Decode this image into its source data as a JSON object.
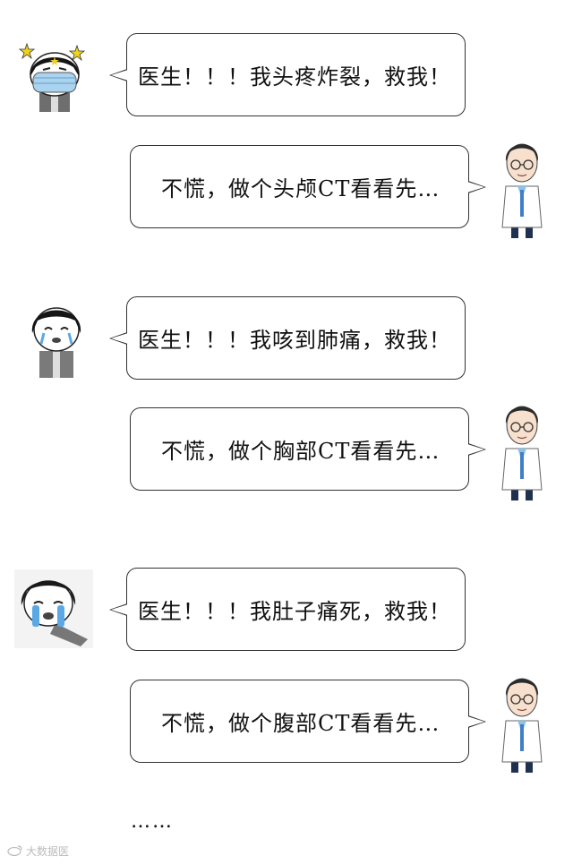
{
  "conversations": [
    {
      "patient": "医生！！！我头疼炸裂，救我！",
      "doctor": "不慌，做个头颅CT看看先…"
    },
    {
      "patient": "医生！！！我咳到肺痛，救我！",
      "doctor": "不慌，做个胸部CT看看先…"
    },
    {
      "patient": "医生！！！我肚子痛死，救我！",
      "doctor": "不慌，做个腹部CT看看先…"
    }
  ],
  "ending": "……",
  "watermark": "大数据医"
}
